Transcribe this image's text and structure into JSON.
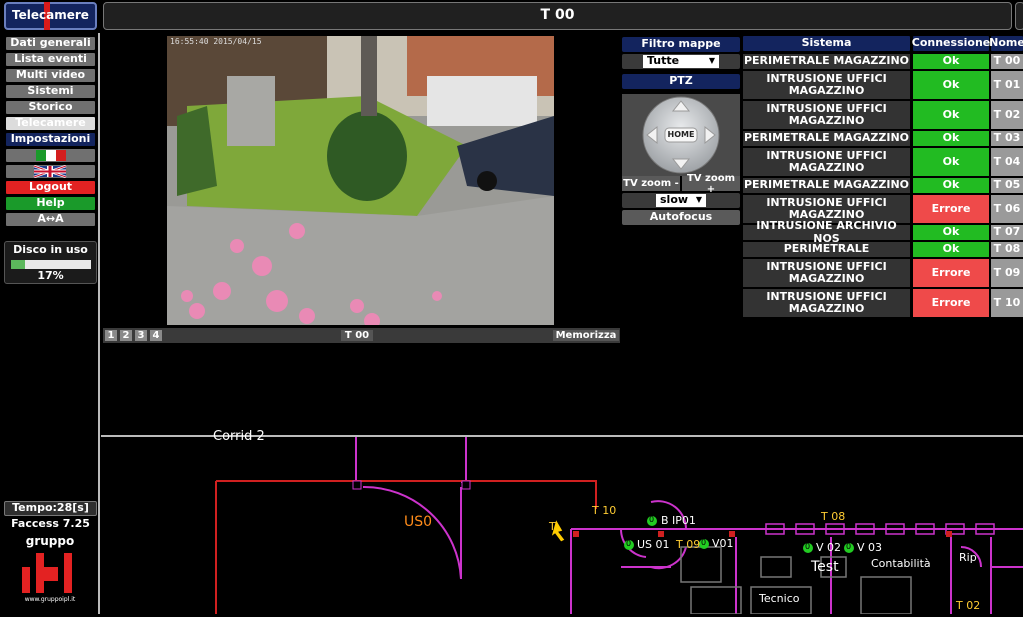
{
  "header": {
    "brand": "Telecamere",
    "title": "T 00"
  },
  "sidebar": {
    "items": [
      {
        "label": "Dati generali",
        "color": "#707070"
      },
      {
        "label": "Lista eventi",
        "color": "#707070"
      },
      {
        "label": "Multi video",
        "color": "#707070"
      },
      {
        "label": "Sistemi",
        "color": "#707070"
      },
      {
        "label": "Storico",
        "color": "#707070"
      },
      {
        "label": "Telecamere",
        "color": "#dcdcdc"
      },
      {
        "label": "Impostazioni",
        "color": "#13245e"
      }
    ],
    "logout": "Logout",
    "help": "Help",
    "font_toggle": "A↔A",
    "disk_label": "Disco in uso",
    "disk_percent": "17%",
    "disk_fill_fraction": 0.17,
    "tempo": "Tempo:28[s]",
    "version": "Faccess 7.25",
    "logo_text": "gruppo",
    "logo_url": "www.gruppoipl.it"
  },
  "video": {
    "timestamp": "16:55:40  2015/04/15",
    "pages": [
      "1",
      "2",
      "3",
      "4"
    ],
    "camera_label": "T 00",
    "save_label": "Memorizza"
  },
  "controls": {
    "filter_title": "Filtro mappe",
    "filter_value": "Tutte",
    "ptz_label": "PTZ",
    "home_label": "HOME",
    "zoom_minus": "TV zoom -",
    "zoom_plus": "TV zoom +",
    "speed_value": "slow",
    "autofocus": "Autofocus"
  },
  "table": {
    "headers": {
      "sistema": "Sistema",
      "connessione": "Connessione",
      "nome": "Nome"
    },
    "rows": [
      {
        "sistema": "PERIMETRALE MAGAZZINO",
        "connessione": "Ok",
        "nome": "T 00"
      },
      {
        "sistema": "INTRUSIONE UFFICI MAGAZZINO",
        "connessione": "Ok",
        "nome": "T 01"
      },
      {
        "sistema": "INTRUSIONE UFFICI MAGAZZINO",
        "connessione": "Ok",
        "nome": "T 02"
      },
      {
        "sistema": "PERIMETRALE MAGAZZINO",
        "connessione": "Ok",
        "nome": "T 03"
      },
      {
        "sistema": "INTRUSIONE UFFICI MAGAZZINO",
        "connessione": "Ok",
        "nome": "T 04"
      },
      {
        "sistema": "PERIMETRALE MAGAZZINO",
        "connessione": "Ok",
        "nome": "T 05"
      },
      {
        "sistema": "INTRUSIONE UFFICI MAGAZZINO",
        "connessione": "Errore",
        "nome": "T 06"
      },
      {
        "sistema": "INTRUSIONE ARCHIVIO NOS",
        "connessione": "Ok",
        "nome": "T 07"
      },
      {
        "sistema": "PERIMETRALE",
        "connessione": "Ok",
        "nome": "T 08"
      },
      {
        "sistema": "INTRUSIONE UFFICI MAGAZZINO",
        "connessione": "Errore",
        "nome": "T 09"
      },
      {
        "sistema": "INTRUSIONE UFFICI MAGAZZINO",
        "connessione": "Errore",
        "nome": "T 10"
      }
    ]
  },
  "map": {
    "room_us0": "US0",
    "cam_t10": "T 10",
    "cam_t08": "T 08",
    "cam_t09": "T 09",
    "cam_t02": "T 02",
    "cam_t_short": "T",
    "sensor_bip01": "B IP01",
    "sensor_us01": "US 01",
    "sensor_v01": "V01",
    "sensor_v02": "V 02",
    "sensor_v03": "V 03",
    "sensor_num": "0",
    "room_test": "Test",
    "room_contabilita": "Contabilità",
    "room_rip": "Rip",
    "room_tecnico": "Tecnico",
    "top_label": "Corrid 2"
  }
}
